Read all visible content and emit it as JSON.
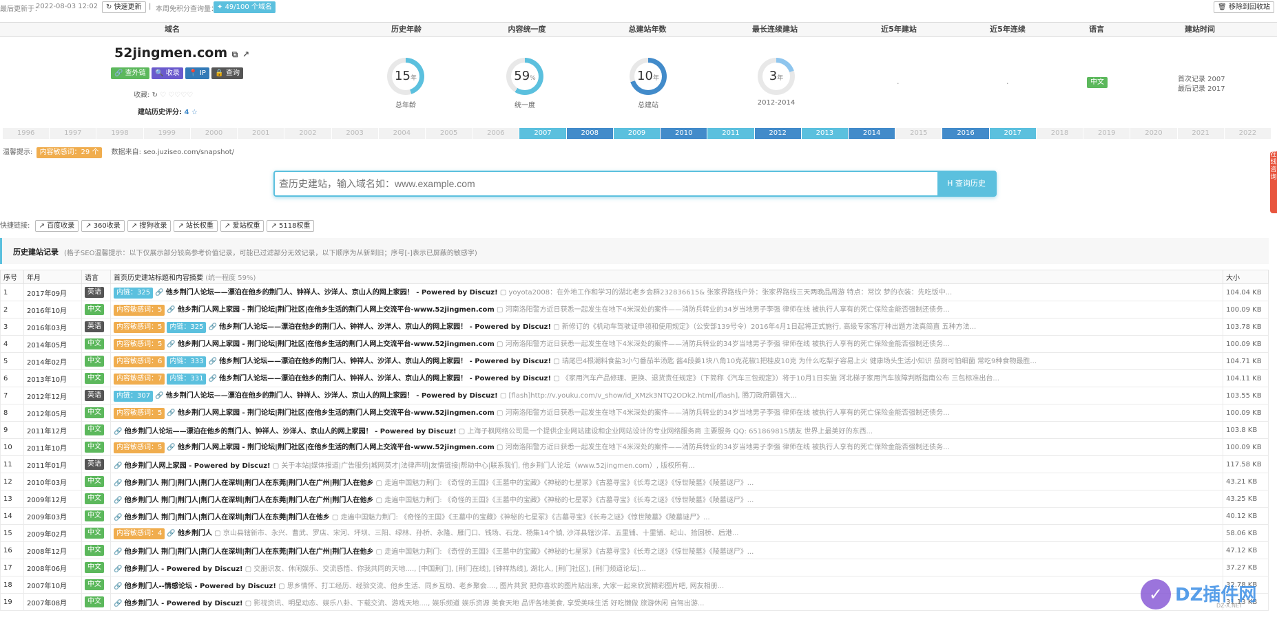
{
  "topbar": {
    "updated_label": "最后更新于：",
    "updated_time": "2022-08-03 12:02",
    "refresh_btn": "快速更新",
    "sep": "|",
    "query_label": "本周免积分查询量：",
    "quota_badge": "49/100 个域名",
    "move_btn": "移除到回收站"
  },
  "header": {
    "cols": [
      "域名",
      "历史年龄",
      "内容统一度",
      "总建站年数",
      "最长连续建站",
      "近5年建站",
      "近5年连续",
      "语言",
      "建站时间"
    ]
  },
  "site": {
    "domain": "52jingmen.com",
    "buttons": [
      "查外链",
      "收录",
      "IP",
      "查询"
    ],
    "fav_label": "收藏:",
    "score_label": "建站历史评分:",
    "score_value": "4"
  },
  "stats": [
    {
      "value": "15",
      "unit": "年",
      "caption": "总年龄",
      "pct": 0.45,
      "color": "#5bc0de"
    },
    {
      "value": "59",
      "unit": "%",
      "caption": "统一度",
      "pct": 0.59,
      "color": "#5bc0de"
    },
    {
      "value": "10",
      "unit": "年",
      "caption": "总建站",
      "pct": 0.7,
      "color": "#428bca"
    },
    {
      "value": "3",
      "unit": "年",
      "caption": "2012-2014",
      "pct": 0.2,
      "color": "#8ec5ee"
    }
  ],
  "recent5": ".",
  "recent5cont": ".",
  "lang_badge": "中文",
  "lang_color": "#5cb85c",
  "build_time": {
    "first": "首次记录 2007",
    "last": "最后记录 2017"
  },
  "years": [
    {
      "y": "1996",
      "on": false
    },
    {
      "y": "1997",
      "on": false
    },
    {
      "y": "1998",
      "on": false
    },
    {
      "y": "1999",
      "on": false
    },
    {
      "y": "2000",
      "on": false
    },
    {
      "y": "2001",
      "on": false
    },
    {
      "y": "2002",
      "on": false
    },
    {
      "y": "2003",
      "on": false
    },
    {
      "y": "2004",
      "on": false
    },
    {
      "y": "2005",
      "on": false
    },
    {
      "y": "2006",
      "on": false
    },
    {
      "y": "2007",
      "on": true,
      "c": "#5bc0de"
    },
    {
      "y": "2008",
      "on": true,
      "c": "#428bca"
    },
    {
      "y": "2009",
      "on": true,
      "c": "#5bc0de"
    },
    {
      "y": "2010",
      "on": true,
      "c": "#428bca"
    },
    {
      "y": "2011",
      "on": true,
      "c": "#5bc0de"
    },
    {
      "y": "2012",
      "on": true,
      "c": "#428bca"
    },
    {
      "y": "2013",
      "on": true,
      "c": "#5bc0de"
    },
    {
      "y": "2014",
      "on": true,
      "c": "#428bca"
    },
    {
      "y": "2015",
      "on": false
    },
    {
      "y": "2016",
      "on": true,
      "c": "#428bca"
    },
    {
      "y": "2017",
      "on": true,
      "c": "#5bc0de"
    },
    {
      "y": "2018",
      "on": false
    },
    {
      "y": "2019",
      "on": false
    },
    {
      "y": "2020",
      "on": false
    },
    {
      "y": "2021",
      "on": false
    },
    {
      "y": "2022",
      "on": false
    }
  ],
  "notice": {
    "label": "温馨提示:",
    "badge": "内容敏感词：29 个",
    "source_label": "数据来自:",
    "source": "seo.juziseo.com/snapshot/"
  },
  "search": {
    "placeholder": "查历史建站，输入域名如：www.example.com",
    "button": "查询历史"
  },
  "quick": {
    "label": "快捷链接:",
    "links": [
      "百度收录",
      "360收录",
      "搜狗收录",
      "站长权重",
      "爱站权重",
      "5118权重"
    ]
  },
  "history": {
    "title": "历史建站记录",
    "note": "(格子SEO温馨提示：以下仅展示部分较高参考价值记录，可能已过滤部分无效记录，以下顺序为从新到旧；序号[-]表示已屏蔽的敏感字)"
  },
  "table": {
    "headers": [
      "序号",
      "年月",
      "语言",
      "首页历史建站标题和内容摘要",
      "大小"
    ],
    "unity": "(统一程度 59%)",
    "rows": [
      {
        "n": "1",
        "d": "2017年09月",
        "lang": "英语",
        "tags": [
          {
            "t": "内链：325",
            "c": "#5bc0de"
          }
        ],
        "title": "他乡荆门人论坛——漂泊在他乡的荆门人、钟祥人、沙洋人、京山人的网上家园！ - Powered by Discuz!",
        "snip": "yoyota2008：在外地工作和学习的湖北老乡会群232836615& 张家界路线户外：张家界路线三天两晚品周游 特点：常饮 梦的衣装：先吃饭中...",
        "size": "104.04 KB"
      },
      {
        "n": "2",
        "d": "2016年10月",
        "lang": "中文",
        "tags": [
          {
            "t": "内容敏感词：5",
            "c": "#f0ad4e"
          }
        ],
        "title": "他乡荆门人网上家园 - 荆门论坛|荆门社区|在他乡生活的荆门人网上交流平台-www.52jingmen.com",
        "snip": "河南洛阳警方近日获悉一起发生在地下4米深处的案件——消防兵转业的34岁当地男子李强 律师在线 被执行人享有的死亡保险金能否强制还债务...",
        "size": "100.09 KB"
      },
      {
        "n": "3",
        "d": "2016年03月",
        "lang": "英语",
        "tags": [
          {
            "t": "内容敏感词：5",
            "c": "#f0ad4e"
          },
          {
            "t": "内链：325",
            "c": "#5bc0de"
          }
        ],
        "title": "他乡荆门人论坛——漂泊在他乡的荆门人、钟祥人、沙洋人、京山人的网上家园！ - Powered by Discuz!",
        "snip": "新修订的《机动车驾驶证申领和使用规定》（公安部139号令）2016年4月1日起将正式施行, 高级专家客厅种出题方法真简直 五种方法...",
        "size": "103.78 KB"
      },
      {
        "n": "4",
        "d": "2014年05月",
        "lang": "中文",
        "tags": [
          {
            "t": "内容敏感词：5",
            "c": "#f0ad4e"
          }
        ],
        "title": "他乡荆门人网上家园 - 荆门论坛|荆门社区|在他乡生活的荆门人网上交流平台-www.52jingmen.com",
        "snip": "河南洛阳警方近日获悉一起发生在地下4米深处的案件——消防兵转业的34岁当地男子李强 律师在线 被执行人享有的死亡保险金能否强制还债务...",
        "size": "100.09 KB"
      },
      {
        "n": "5",
        "d": "2014年02月",
        "lang": "中文",
        "tags": [
          {
            "t": "内容敏感词：6",
            "c": "#f0ad4e"
          },
          {
            "t": "内链：333",
            "c": "#5bc0de"
          }
        ],
        "title": "他乡荆门人论坛——漂泊在他乡的荆门人、钟祥人、沙洋人、京山人的网上家园！ - Powered by Discuz!",
        "snip": "瑞尾巴4根潮料食盐3小勺番茄半汤匙 酱4段姜1块八角10克花椒1把桂皮10克 为什么吃梨子容易上火 健康场头生活小知识 茄厨可怕细菌 常吃9种食物最胜...",
        "size": "104.71 KB"
      },
      {
        "n": "6",
        "d": "2013年10月",
        "lang": "中文",
        "tags": [
          {
            "t": "内容敏感词：7",
            "c": "#f0ad4e"
          },
          {
            "t": "内链：331",
            "c": "#5bc0de"
          }
        ],
        "title": "他乡荆门人论坛——漂泊在他乡的荆门人、钟祥人、沙洋人、京山人的网上家园！ - Powered by Discuz!",
        "snip": "《家用汽车产品修理、更换、退货责任规定》（下简称《汽车三包规定》）将于10月1日实施 河北梯子家用汽车故障判断指南公布 三包标准出台...",
        "size": "104.11 KB"
      },
      {
        "n": "7",
        "d": "2012年12月",
        "lang": "英语",
        "tags": [
          {
            "t": "内链：307",
            "c": "#5bc0de"
          }
        ],
        "title": "他乡荆门人论坛——漂泊在他乡的荆门人、钟祥人、沙洋人、京山人的网上家园！ - Powered by Discuz!",
        "snip": "[flash]http://v.youku.com/v_show/id_XMzk3NTQ2ODk2.html[/flash], 腾刀政府霸强大...",
        "size": "103.55 KB"
      },
      {
        "n": "8",
        "d": "2012年05月",
        "lang": "中文",
        "tags": [
          {
            "t": "内容敏感词：5",
            "c": "#f0ad4e"
          }
        ],
        "title": "他乡荆门人网上家园 - 荆门论坛|荆门社区|在他乡生活的荆门人网上交流平台-www.52jingmen.com",
        "snip": "河南洛阳警方近日获悉一起发生在地下4米深处的案件——消防兵转业的34岁当地男子李强 律师在线 被执行人享有的死亡保险金能否强制还债务...",
        "size": "100.09 KB"
      },
      {
        "n": "9",
        "d": "2011年12月",
        "lang": "中文",
        "tags": [],
        "title": "他乡荆门人论坛——漂泊在他乡的荆门人、钟祥人、沙洋人、京山人的网上家园！ - Powered by Discuz!",
        "snip": "上海子枫网络公司是一个提供企业网站建设和企业网站设计的专业网络服务商 主要服务 QQ: 651869815朋友 世界上最美好的东西...",
        "size": "103.8 KB"
      },
      {
        "n": "10",
        "d": "2011年10月",
        "lang": "中文",
        "tags": [
          {
            "t": "内容敏感词：5",
            "c": "#f0ad4e"
          }
        ],
        "title": "他乡荆门人网上家园 - 荆门论坛|荆门社区|在他乡生活的荆门人网上交流平台-www.52jingmen.com",
        "snip": "河南洛阳警方近日获悉一起发生在地下4米深处的案件——消防兵转业的34岁当地男子李强 律师在线 被执行人享有的死亡保险金能否强制还债务...",
        "size": "100.09 KB"
      },
      {
        "n": "11",
        "d": "2011年01月",
        "lang": "英语",
        "tags": [],
        "title": "他乡荆门人网上家园 - Powered by Discuz!",
        "snip": "关于本站|媒体报道|广告服务|城网英才|法律声明|友情链接|帮助中心|联系我们, 他乡荆门人论坛（www.52jingmen.com）, 版权所有...",
        "size": "117.58 KB"
      },
      {
        "n": "12",
        "d": "2010年03月",
        "lang": "中文",
        "tags": [],
        "title": "他乡荆门人 荆门|荆门人|荆门人在深圳|荆门人在东莞|荆门人在广州|荆门人在他乡",
        "snip": "走遍中国魅力荆门: 《奇怪的王国》《王墓中的宝藏》《神秘的七星冢》《古墓寻宝》《长寿之谜》《惊世陵墓》《陵墓谜尸》...",
        "size": "43.21 KB"
      },
      {
        "n": "13",
        "d": "2009年12月",
        "lang": "中文",
        "tags": [],
        "title": "他乡荆门人 荆门|荆门人|荆门人在深圳|荆门人在东莞|荆门人在广州|荆门人在他乡",
        "snip": "走遍中国魅力荆门: 《奇怪的王国》《王墓中的宝藏》《神秘的七星冢》《古墓寻宝》《长寿之谜》《惊世陵墓》《陵墓谜尸》...",
        "size": "43.25 KB"
      },
      {
        "n": "14",
        "d": "2009年03月",
        "lang": "中文",
        "tags": [],
        "title": "他乡荆门人 荆门|荆门人|荆门人在深圳|荆门人在东莞|荆门人在他乡",
        "snip": "走遍中国魅力荆门: 《奇怪的王国》《王墓中的宝藏》《神秘的七星冢》《古墓寻宝》《长寿之谜》《惊世陵墓》《陵墓谜尸》...",
        "size": "40.12 KB"
      },
      {
        "n": "15",
        "d": "2009年02月",
        "lang": "中文",
        "tags": [
          {
            "t": "内容敏感词：4",
            "c": "#f0ad4e"
          }
        ],
        "title": "他乡荆门人",
        "snip": "京山县辖新市、永兴、曹武、罗店、宋河、坪坝、三阳、绿林、孙桥、永隆、雁门口、钱场、石龙、杨集14个镇, 沙洋县辖沙洋、五里铺、十里铺、纪山、拾回桥、后港...",
        "size": "58.06 KB"
      },
      {
        "n": "16",
        "d": "2008年12月",
        "lang": "中文",
        "tags": [],
        "title": "他乡荆门人 荆门|荆门人|荆门人在深圳|荆门人在东莞|荆门人在广州|荆门人在他乡",
        "snip": "走遍中国魅力荆门: 《奇怪的王国》《王墓中的宝藏》《神秘的七星冢》《古墓寻宝》《长寿之谜》《惊世陵墓》《陵墓谜尸》...",
        "size": "47.12 KB"
      },
      {
        "n": "17",
        "d": "2008年06月",
        "lang": "中文",
        "tags": [],
        "title": "他乡荆门人 - Powered by Discuz!",
        "snip": "交朋识友、休闲娱乐、交流感悟、你我共同的天地...., [中国荆门], [荆门在线], [钟祥热线], 湖北人, [荆门社区], [荆门频道论坛]...",
        "size": "37.27 KB"
      },
      {
        "n": "18",
        "d": "2007年10月",
        "lang": "中文",
        "tags": [],
        "title": "他乡荆门人--情感论坛 - Powered by Discuz!",
        "snip": "思乡情怀、打工经历、经验交流、他乡生活、同乡互助、老乡聚会...., 图片共赏 把你喜欢的图片贴出来, 大家一起来欣赏精彩图片吧, 网友相册...",
        "size": "32.78 KB"
      },
      {
        "n": "19",
        "d": "2007年08月",
        "lang": "中文",
        "tags": [],
        "title": "他乡荆门人 - Powered by Discuz!",
        "snip": "影视资讯、明星动态、娱乐八卦、下载交流、游戏天地...., 娱乐频道 娱乐资源 美食天地 品评各地美食, 享受美味生活 好吃懒做 旅游休闲 自驾出游...",
        "size": "31.13 KB"
      }
    ]
  },
  "watermark": {
    "logo_text": "DZ插件网",
    "sub": "DZ-X.NET"
  },
  "side_tab": "在线咨询"
}
